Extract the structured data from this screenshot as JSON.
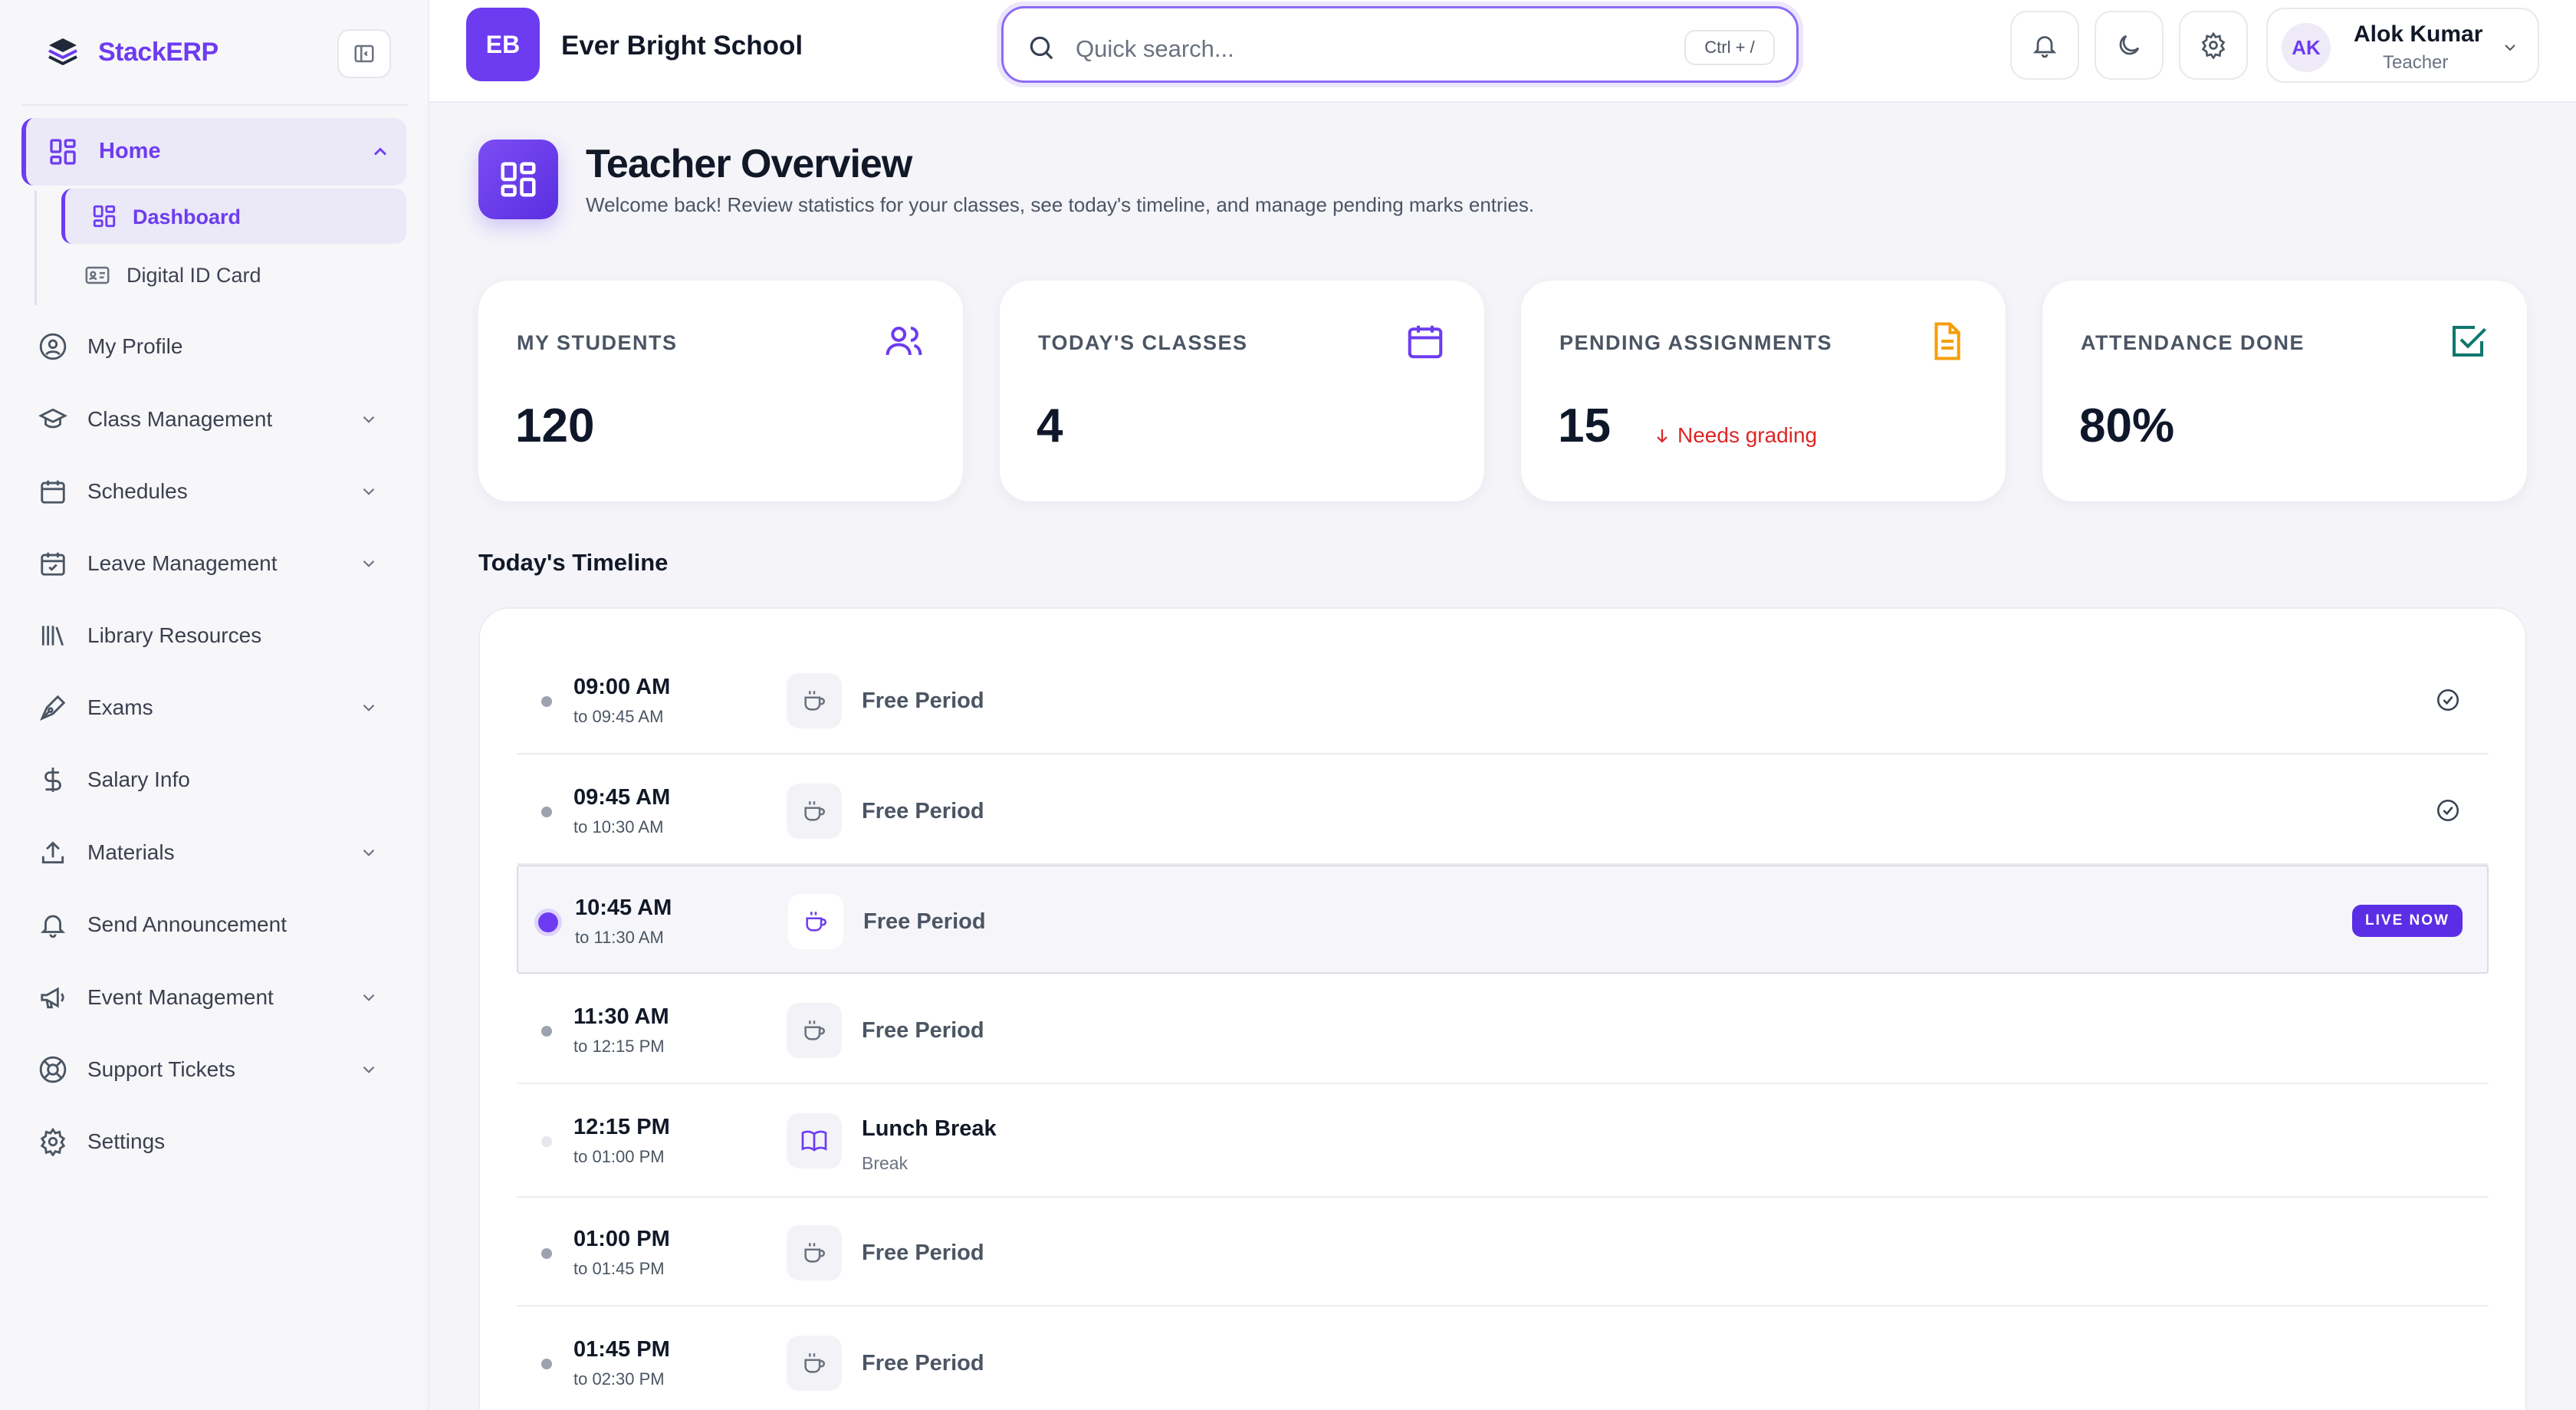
{
  "brand": {
    "name": "StackERP"
  },
  "sidebar": {
    "home": {
      "label": "Home"
    },
    "sub_items": [
      {
        "label": "Dashboard"
      },
      {
        "label": "Digital ID Card"
      }
    ],
    "items": [
      {
        "label": "My Profile"
      },
      {
        "label": "Class Management"
      },
      {
        "label": "Schedules"
      },
      {
        "label": "Leave Management"
      },
      {
        "label": "Library Resources"
      },
      {
        "label": "Exams"
      },
      {
        "label": "Salary Info"
      },
      {
        "label": "Materials"
      },
      {
        "label": "Send Announcement"
      },
      {
        "label": "Event Management"
      },
      {
        "label": "Support Tickets"
      },
      {
        "label": "Settings"
      }
    ]
  },
  "header": {
    "school_initials": "EB",
    "school_name": "Ever Bright School",
    "search": {
      "placeholder": "Quick search...",
      "shortcut": "Ctrl + /"
    },
    "user": {
      "initials": "AK",
      "name": "Alok Kumar",
      "role": "Teacher"
    }
  },
  "page": {
    "title": "Teacher Overview",
    "subtitle": "Welcome back! Review statistics for your classes, see today's timeline, and manage pending marks entries."
  },
  "stats": [
    {
      "title": "MY STUDENTS",
      "value": "120",
      "icon": "users-icon",
      "color": "#6d3cf0"
    },
    {
      "title": "TODAY'S CLASSES",
      "value": "4",
      "icon": "calendar-icon",
      "color": "#6d3cf0"
    },
    {
      "title": "PENDING ASSIGNMENTS",
      "value": "15",
      "note": "Needs grading",
      "icon": "document-icon",
      "color": "#f59e0b"
    },
    {
      "title": "ATTENDANCE DONE",
      "value": "80%",
      "icon": "check-square-icon",
      "color": "#0f766e"
    }
  ],
  "timeline": {
    "title": "Today's Timeline",
    "live_label": "LIVE NOW",
    "rows": [
      {
        "time": "09:00 AM",
        "to": "to 09:45 AM",
        "label": "Free Period",
        "status": "done"
      },
      {
        "time": "09:45 AM",
        "to": "to 10:30 AM",
        "label": "Free Period",
        "status": "done"
      },
      {
        "time": "10:45 AM",
        "to": "to 11:30 AM",
        "label": "Free Period",
        "status": "live"
      },
      {
        "time": "11:30 AM",
        "to": "to 12:15 PM",
        "label": "Free Period",
        "status": "upcoming"
      },
      {
        "time": "12:15 PM",
        "to": "to 01:00 PM",
        "label": "Lunch Break",
        "sub": "Break",
        "status": "break"
      },
      {
        "time": "01:00 PM",
        "to": "to 01:45 PM",
        "label": "Free Period",
        "status": "upcoming"
      },
      {
        "time": "01:45 PM",
        "to": "to 02:30 PM",
        "label": "Free Period",
        "status": "upcoming"
      }
    ]
  }
}
